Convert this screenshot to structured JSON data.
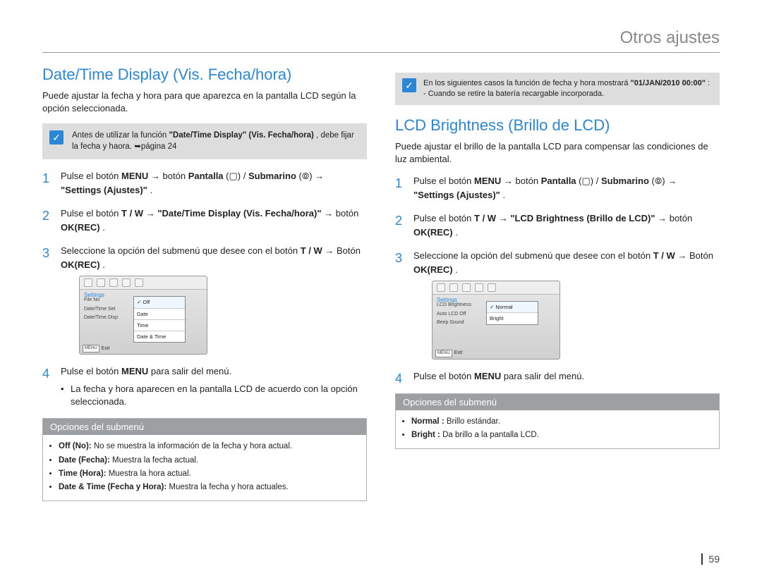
{
  "header": {
    "title": "Otros ajustes"
  },
  "page_number": "59",
  "left": {
    "heading": "Date/Time Display (Vis. Fecha/hora)",
    "intro": "Puede ajustar la fecha y hora para que aparezca en la pantalla LCD según la opción seleccionada.",
    "note": {
      "prefix": "Antes de utilizar la función ",
      "bold": "\"Date/Time Display\" (Vis. Fecha/hora)",
      "after": " , debe fijar la fecha y haora. ➥página 24"
    },
    "steps": {
      "s1": {
        "part1": "Pulse el botón ",
        "menu": "MENU",
        "arrow1": " → botón ",
        "pantalla": "Pantalla",
        "slash": " /",
        "submarino": "Submarino",
        "arrow2": " → ",
        "settings": "\"Settings (Ajustes)\"",
        "end": "."
      },
      "s2": {
        "part1": "Pulse el botón ",
        "tw": "T / W",
        "arrow1": " → ",
        "target": "\"Date/Time Display (Vis. Fecha/hora)\"",
        "arrow2": " → botón ",
        "ok": "OK(REC)",
        "end": "."
      },
      "s3": {
        "part1": "Seleccione la opción del submenú que desee con el botón ",
        "tw": "T / W",
        "arrow1": " → Botón ",
        "ok": "OK(REC)",
        "end": "."
      },
      "s4": {
        "part1": "Pulse el botón ",
        "menu": "MENU",
        "part2": " para salir del menú.",
        "bullet": "La fecha y hora aparecen en la pantalla LCD de acuerdo con la opción seleccionada."
      }
    },
    "screen": {
      "settings_label": "Settings",
      "list": [
        "File No",
        "Date/Time Set",
        "Date/Time Disp"
      ],
      "popup": [
        "Off",
        "Date",
        "Time",
        "Date & Time"
      ],
      "exit": "Exit",
      "menu_btn": "MENU"
    },
    "submenu": {
      "title": "Opciones del submenú",
      "items": [
        {
          "bold": "Off (No):",
          "text": " No se muestra la información de la fecha y hora actual."
        },
        {
          "bold": "Date (Fecha):",
          "text": " Muestra la fecha actual."
        },
        {
          "bold": "Time (Hora):",
          "text": " Muestra la hora actual."
        },
        {
          "bold": "Date & Time (Fecha y Hora):",
          "text": " Muestra la fecha y hora actuales."
        }
      ]
    }
  },
  "right": {
    "note": {
      "line1_pre": "En los siguientes casos la función de fecha y hora mostrará ",
      "line1_bold": "\"01/JAN/2010 00:00\"",
      "line1_post": ":",
      "line2": "- Cuando se retire la batería recargable incorporada."
    },
    "heading": "LCD Brightness (Brillo de LCD)",
    "intro": "Puede ajustar el brillo de la pantalla LCD para compensar las condiciones de luz ambiental.",
    "steps": {
      "s1": {
        "part1": "Pulse el botón ",
        "menu": "MENU",
        "arrow1": " → botón ",
        "pantalla": "Pantalla",
        "slash": " /",
        "submarino": "Submarino",
        "arrow2": " → ",
        "settings": "\"Settings (Ajustes)\"",
        "end": "."
      },
      "s2": {
        "part1": "Pulse el botón ",
        "tw": "T / W",
        "arrow1": " → ",
        "target": "\"LCD Brightness (Brillo de LCD)\"",
        "arrow2": " → botón ",
        "ok": "OK(REC)",
        "end": "."
      },
      "s3": {
        "part1": "Seleccione la opción del submenú que desee con el botón ",
        "tw": "T / W",
        "arrow1": " → Botón ",
        "ok": "OK(REC)",
        "end": "."
      },
      "s4": {
        "part1": "Pulse el botón ",
        "menu": "MENU",
        "part2": " para salir del menú."
      }
    },
    "screen": {
      "settings_label": "Settings",
      "list": [
        "LCD Brightness",
        "Auto LCD Off",
        "Beep Sound"
      ],
      "popup": [
        "Normal",
        "Bright"
      ],
      "exit": "Exit",
      "menu_btn": "MENU"
    },
    "submenu": {
      "title": "Opciones del submenú",
      "items": [
        {
          "bold": "Normal :",
          "text": " Brillo estándar."
        },
        {
          "bold": "Bright :",
          "text": " Da brillo a la pantalla LCD."
        }
      ]
    }
  }
}
